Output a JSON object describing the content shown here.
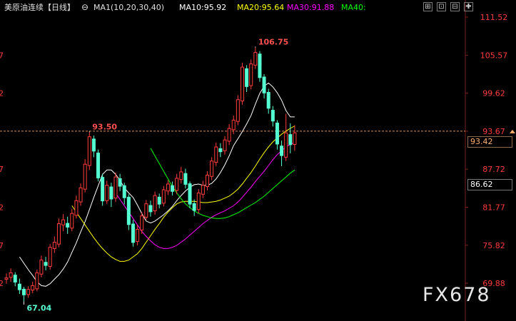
{
  "header": {
    "title": "美原油连续【日线】",
    "indicator": "MA1(10,20,30,40)",
    "ma10": "MA10:95.92",
    "ma20": "MA20:95.64",
    "ma30": "MA30:91.88",
    "ma40": "MA40:",
    "colors": {
      "title": "#e0e0e0",
      "ma10": "#ffffff",
      "ma20": "#ffff00",
      "ma30": "#ff00ff",
      "ma40": "#00ff00"
    }
  },
  "window_buttons": [
    "⊞",
    "⊡",
    "⊟",
    "✚"
  ],
  "price_labels": [
    "111.52",
    "105.57",
    "99.62",
    "93.67",
    "87.72",
    "81.77",
    "75.82",
    "69.88"
  ],
  "left_edge_labels": [
    "7",
    "2",
    "7",
    "2",
    "7",
    "2"
  ],
  "price_boxes": {
    "current": "93.42",
    "cursor": "86.62"
  },
  "annotations": {
    "high": "106.75",
    "mid_high": "93.50",
    "low": "67.04"
  },
  "watermark": "FX678",
  "chart_data": {
    "type": "candlestick",
    "title": "美原油连续【日线】",
    "ylim": [
      67.5,
      112.5
    ],
    "y_ticks": [
      111.52,
      105.57,
      99.62,
      93.67,
      87.72,
      81.77,
      75.82,
      69.88
    ],
    "up_color": "#ff3c3c",
    "down_color": "#54ffd2",
    "reference_price": 93.67,
    "candles": [
      [
        70.5,
        70.7,
        71.4,
        69.8
      ],
      [
        70.8,
        71.5,
        72.2,
        70.1
      ],
      [
        71.2,
        70.0,
        71.6,
        69.4
      ],
      [
        69.8,
        68.8,
        70.6,
        68.2
      ],
      [
        69.0,
        68.0,
        69.3,
        67.04
      ],
      [
        68.1,
        68.9,
        69.4,
        67.6
      ],
      [
        68.8,
        69.5,
        70.1,
        68.3
      ],
      [
        69.0,
        71.5,
        72.0,
        68.6
      ],
      [
        71.3,
        73.5,
        74.2,
        70.8
      ],
      [
        73.2,
        72.6,
        74.0,
        71.9
      ],
      [
        72.5,
        75.5,
        76.0,
        72.0
      ],
      [
        75.3,
        76.3,
        77.2,
        74.6
      ],
      [
        76.0,
        79.2,
        80.0,
        75.5
      ],
      [
        79.0,
        79.8,
        80.7,
        78.0
      ],
      [
        79.3,
        78.6,
        80.3,
        77.6
      ],
      [
        78.5,
        80.8,
        81.5,
        78.0
      ],
      [
        80.5,
        82.8,
        83.6,
        80.0
      ],
      [
        82.6,
        84.8,
        85.5,
        82.0
      ],
      [
        84.6,
        88.5,
        89.3,
        84.1
      ],
      [
        88.3,
        92.8,
        93.5,
        87.6
      ],
      [
        92.5,
        90.5,
        93.0,
        89.6
      ],
      [
        90.3,
        86.3,
        90.8,
        85.8
      ],
      [
        86.5,
        82.7,
        87.0,
        82.0
      ],
      [
        82.8,
        85.2,
        85.9,
        82.3
      ],
      [
        85.0,
        83.0,
        85.6,
        81.8
      ],
      [
        83.2,
        86.5,
        87.2,
        82.6
      ],
      [
        86.3,
        85.0,
        87.0,
        84.3
      ],
      [
        85.2,
        83.2,
        85.6,
        82.2
      ],
      [
        83.4,
        79.0,
        83.8,
        78.2
      ],
      [
        79.2,
        76.2,
        79.8,
        75.6
      ],
      [
        76.4,
        78.3,
        79.0,
        75.8
      ],
      [
        78.2,
        80.4,
        81.0,
        77.6
      ],
      [
        80.2,
        82.3,
        82.9,
        79.8
      ],
      [
        82.1,
        81.0,
        82.8,
        80.3
      ],
      [
        81.2,
        83.6,
        84.2,
        80.6
      ],
      [
        83.4,
        82.2,
        83.9,
        81.6
      ],
      [
        82.4,
        84.5,
        85.1,
        81.9
      ],
      [
        84.3,
        85.4,
        86.0,
        83.7
      ],
      [
        85.2,
        84.2,
        85.8,
        83.6
      ],
      [
        84.4,
        86.3,
        87.0,
        83.8
      ],
      [
        86.1,
        87.3,
        88.1,
        85.5
      ],
      [
        87.1,
        85.3,
        87.8,
        84.7
      ],
      [
        85.5,
        82.2,
        85.8,
        81.6
      ],
      [
        82.4,
        81.2,
        83.0,
        80.4
      ],
      [
        81.4,
        84.0,
        84.6,
        80.8
      ],
      [
        83.8,
        85.2,
        85.9,
        83.2
      ],
      [
        85.0,
        86.8,
        87.4,
        84.4
      ],
      [
        86.6,
        89.0,
        89.6,
        86.0
      ],
      [
        88.8,
        91.2,
        91.9,
        88.2
      ],
      [
        91.0,
        90.4,
        91.8,
        89.6
      ],
      [
        90.6,
        92.3,
        92.9,
        90.0
      ],
      [
        92.1,
        94.1,
        94.8,
        91.5
      ],
      [
        93.9,
        95.4,
        96.1,
        93.2
      ],
      [
        95.2,
        98.6,
        99.3,
        94.6
      ],
      [
        98.4,
        103.7,
        104.4,
        97.8
      ],
      [
        103.5,
        100.6,
        104.0,
        99.8
      ],
      [
        100.8,
        104.2,
        104.9,
        100.2
      ],
      [
        104.0,
        106.0,
        106.75,
        103.4
      ],
      [
        105.8,
        102.0,
        106.2,
        101.4
      ],
      [
        102.2,
        99.6,
        102.6,
        98.8
      ],
      [
        99.8,
        97.2,
        100.3,
        96.4
      ],
      [
        97.0,
        95.2,
        97.6,
        94.4
      ],
      [
        95.0,
        91.6,
        95.4,
        90.8
      ],
      [
        91.4,
        89.8,
        92.2,
        88.2
      ],
      [
        89.6,
        93.4,
        96.4,
        89.0
      ],
      [
        93.2,
        91.5,
        94.9,
        90.2
      ],
      [
        91.6,
        93.42,
        94.6,
        90.6
      ]
    ],
    "ma_series": [
      {
        "name": "MA10",
        "color": "#ffffff",
        "values": [
          74.0,
          73.0,
          72.0,
          71.1,
          70.1,
          69.5,
          69.4,
          69.8,
          70.5,
          71.2,
          72.1,
          73.2,
          74.7,
          76.2,
          77.9,
          79.5,
          81.4,
          83.3,
          85.1,
          86.9,
          87.6,
          87.6,
          86.9,
          86.0,
          84.8,
          84.0,
          83.3,
          82.1,
          80.8,
          79.6,
          79.3,
          79.6,
          80.1,
          80.6,
          81.2,
          81.9,
          82.8,
          83.6,
          84.3,
          84.9,
          85.3,
          85.4,
          85.2,
          85.2,
          85.5,
          86.2,
          87.2,
          88.4,
          89.8,
          91.4,
          92.5,
          93.6,
          94.8,
          96.1,
          97.9,
          99.6,
          100.7,
          101.2,
          100.6,
          99.7,
          98.5,
          96.9,
          95.9,
          95.9
        ]
      },
      {
        "name": "MA20",
        "color": "#ffff00",
        "values": [
          82.0,
          81.0,
          80.0,
          79.0,
          78.0,
          77.0,
          76.1,
          75.3,
          74.6,
          74.0,
          73.6,
          73.3,
          73.3,
          73.5,
          74.0,
          74.5,
          75.3,
          76.3,
          77.3,
          78.3,
          79.2,
          80.2,
          81.0,
          81.7,
          82.3,
          82.6,
          82.7,
          82.7,
          82.7,
          82.6,
          82.5,
          82.5,
          82.6,
          82.7,
          82.9,
          83.2,
          83.5,
          84.0,
          84.6,
          85.4,
          86.3,
          87.2,
          88.2,
          89.3,
          90.3,
          91.2,
          92.0,
          92.6,
          93.2,
          93.7,
          94.1,
          94.5
        ]
      },
      {
        "name": "MA30",
        "color": "#ff00ff",
        "values": [
          84.0,
          83.0,
          82.0,
          81.0,
          80.0,
          79.0,
          78.0,
          77.2,
          76.5,
          75.9,
          75.5,
          75.3,
          75.3,
          75.5,
          75.8,
          76.3,
          76.8,
          77.4,
          78.0,
          78.6,
          79.2,
          79.7,
          80.2,
          80.6,
          80.9,
          81.2,
          81.6,
          82.0,
          82.6,
          83.3,
          84.1,
          84.9,
          85.8,
          86.6,
          87.4,
          88.3,
          89.2,
          90.0,
          90.6,
          91.2,
          91.6,
          91.9
        ]
      },
      {
        "name": "MA40",
        "color": "#00ff00",
        "values": [
          91.0,
          89.8,
          88.6,
          87.4,
          86.2,
          85.0,
          84.0,
          83.1,
          82.3,
          81.7,
          81.2,
          80.8,
          80.5,
          80.3,
          80.1,
          80.0,
          80.0,
          80.1,
          80.3,
          80.6,
          80.9,
          81.3,
          81.7,
          82.1,
          82.5,
          83.0,
          83.5,
          84.1,
          84.7,
          85.3,
          85.9,
          86.5,
          87.1,
          87.6
        ]
      }
    ]
  }
}
